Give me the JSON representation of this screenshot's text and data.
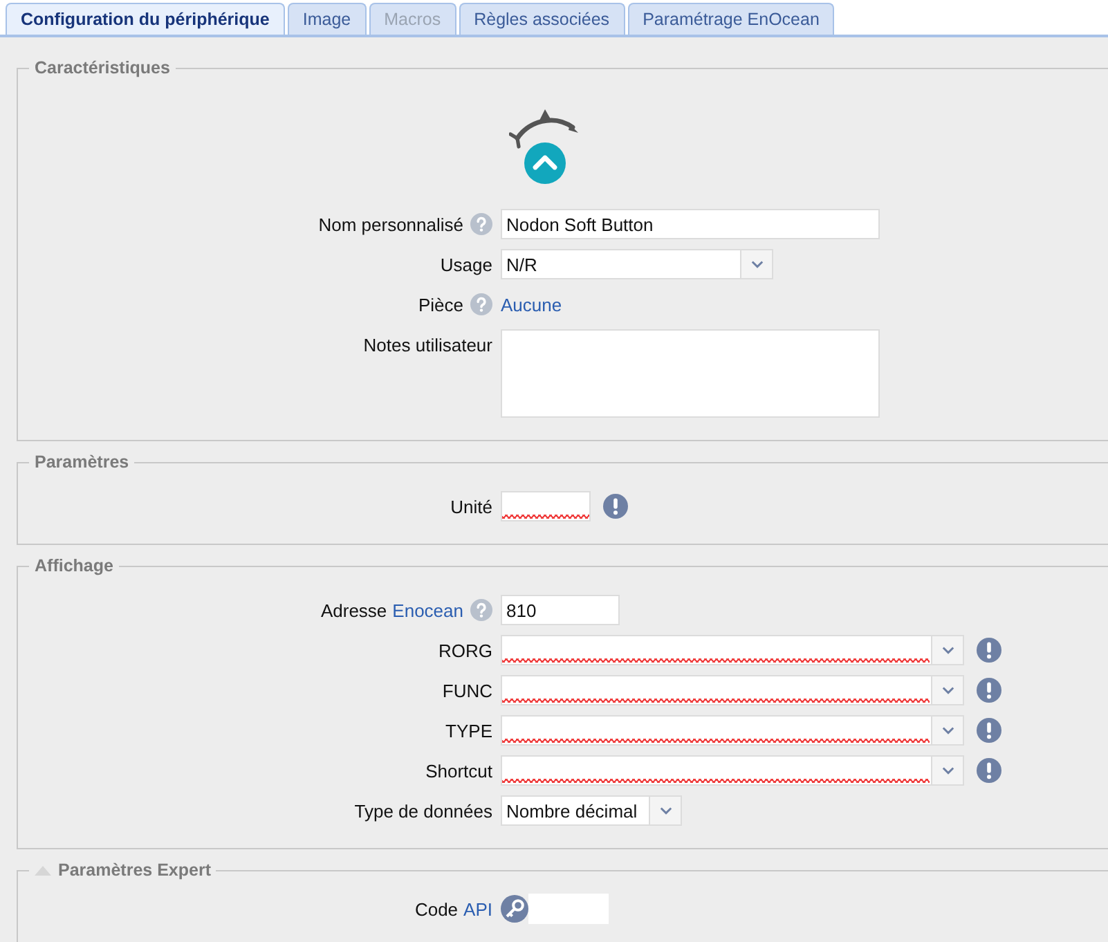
{
  "tabs": [
    {
      "label": "Configuration du périphérique",
      "selected": true,
      "disabled": false
    },
    {
      "label": "Image",
      "selected": false,
      "disabled": false
    },
    {
      "label": "Macros",
      "selected": false,
      "disabled": true
    },
    {
      "label": "Règles associées",
      "selected": false,
      "disabled": false
    },
    {
      "label": "Paramétrage EnOcean",
      "selected": false,
      "disabled": false
    }
  ],
  "sections": [
    {
      "title": "Caractéristiques",
      "device_icon": true,
      "rows": [
        {
          "kind": "text",
          "label": "Nom personnalisé",
          "help": true,
          "value": "Nodon Soft Button"
        },
        {
          "kind": "select",
          "label": "Usage",
          "value": "N/R"
        },
        {
          "kind": "link",
          "label": "Pièce",
          "help": true,
          "value": "Aucune"
        },
        {
          "kind": "textarea",
          "label": "Notes utilisateur"
        }
      ]
    },
    {
      "title": "Paramètres",
      "rows": [
        {
          "kind": "text",
          "label": "Unité",
          "warning": true,
          "invalid": true
        }
      ]
    },
    {
      "title": "Affichage",
      "rows": [
        {
          "kind": "text",
          "label": "Adresse",
          "label_link": "Enocean",
          "help": true,
          "value": "810"
        },
        {
          "kind": "combo",
          "label": "RORG",
          "warning": true,
          "invalid": true
        },
        {
          "kind": "combo",
          "label": "FUNC",
          "warning": true,
          "invalid": true
        },
        {
          "kind": "combo",
          "label": "TYPE",
          "warning": true,
          "invalid": true
        },
        {
          "kind": "combo",
          "label": "Shortcut",
          "warning": true,
          "invalid": true
        },
        {
          "kind": "select",
          "label": "Type de données",
          "value": "Nombre décimal"
        }
      ]
    },
    {
      "title": "Paramètres Expert",
      "collapsible": true,
      "expanded": true,
      "rows": [
        {
          "kind": "key",
          "label": "Code",
          "label_link": "API"
        }
      ]
    }
  ]
}
